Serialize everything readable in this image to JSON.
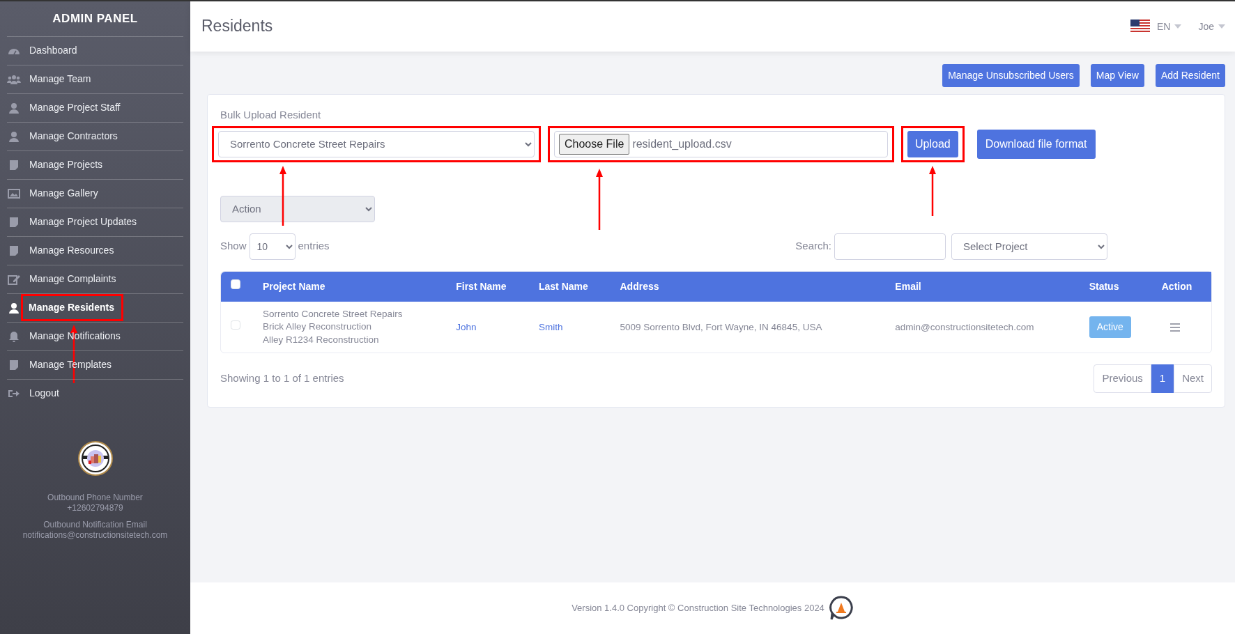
{
  "sidebar": {
    "title": "ADMIN PANEL",
    "items": [
      {
        "label": "Dashboard",
        "selected": false,
        "highlighted": false
      },
      {
        "label": "Manage Team",
        "selected": false,
        "highlighted": false
      },
      {
        "label": "Manage Project Staff",
        "selected": false,
        "highlighted": false
      },
      {
        "label": "Manage Contractors",
        "selected": false,
        "highlighted": false
      },
      {
        "label": "Manage Projects",
        "selected": false,
        "highlighted": false
      },
      {
        "label": "Manage Gallery",
        "selected": false,
        "highlighted": false
      },
      {
        "label": "Manage Project Updates",
        "selected": false,
        "highlighted": false
      },
      {
        "label": "Manage Resources",
        "selected": false,
        "highlighted": false
      },
      {
        "label": "Manage Complaints",
        "selected": false,
        "highlighted": false
      },
      {
        "label": "Manage Residents",
        "selected": true,
        "highlighted": true
      },
      {
        "label": "Manage Notifications",
        "selected": false,
        "highlighted": false
      },
      {
        "label": "Manage Templates",
        "selected": false,
        "highlighted": false
      },
      {
        "label": "Logout",
        "selected": false,
        "highlighted": false
      }
    ],
    "phone_label": "Outbound Phone Number",
    "phone": "+12602794879",
    "email_label": "Outbound Notification Email",
    "email": "notifications@constructionsitetech.com"
  },
  "header": {
    "title": "Residents",
    "language": "EN",
    "user": "Joe"
  },
  "toolbar": {
    "buttons": [
      "Manage Unsubscribed Users",
      "Map View",
      "Add Resident"
    ]
  },
  "bulk_upload": {
    "label": "Bulk Upload Resident",
    "project_select": {
      "value": "Sorrento Concrete Street Repairs",
      "highlighted": true
    },
    "file_input": {
      "button": "Choose File",
      "file_name": "resident_upload.csv",
      "highlighted": true
    },
    "upload_button": {
      "label": "Upload",
      "highlighted": true
    },
    "download_button": {
      "label": "Download file format"
    }
  },
  "action_select": {
    "value": "Action",
    "disabled": true
  },
  "length": {
    "prefix": "Show",
    "value": "10",
    "suffix": "entries"
  },
  "search": {
    "label": "Search:"
  },
  "project_filter": {
    "value": "Select Project"
  },
  "table": {
    "select_all": {
      "checked": false
    },
    "columns": [
      "Project Name",
      "First Name",
      "Last Name",
      "Address",
      "Email",
      "Status",
      "Action"
    ],
    "rows": [
      {
        "checked": false,
        "projects": [
          "Sorrento Concrete Street Repairs",
          "Brick Alley Reconstruction",
          "Alley R1234 Reconstruction"
        ],
        "first_name": "John",
        "last_name": "Smith",
        "address": "5009 Sorrento Blvd, Fort Wayne, IN 46845, USA",
        "email": "admin@constructionsitetech.com",
        "status": "Active"
      }
    ]
  },
  "info": "Showing 1 to 1 of 1 entries",
  "pagination": [
    {
      "label": "Previous",
      "selected": false
    },
    {
      "label": "1",
      "selected": true
    },
    {
      "label": "Next",
      "selected": false
    }
  ],
  "footer": {
    "text": "Version 1.4.0 Copyright © Construction Site Technologies 2024"
  }
}
